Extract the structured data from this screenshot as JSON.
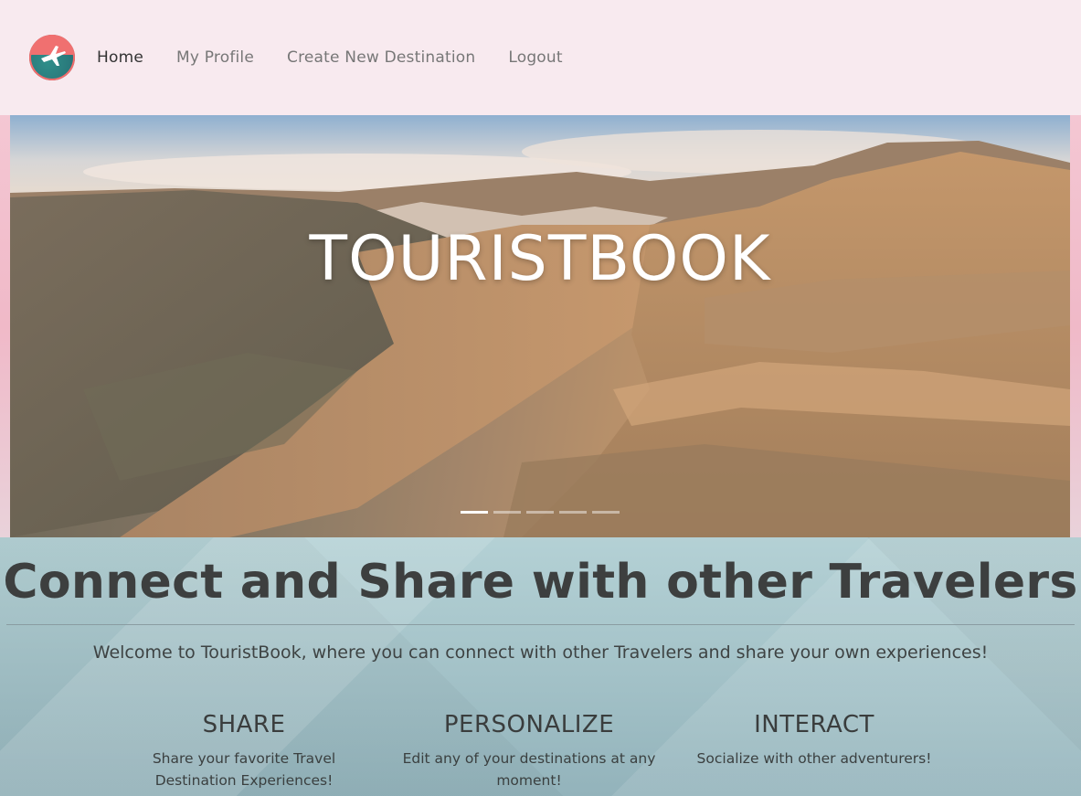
{
  "nav": {
    "links": [
      {
        "label": "Home",
        "active": true
      },
      {
        "label": "My Profile",
        "active": false
      },
      {
        "label": "Create New Destination",
        "active": false
      },
      {
        "label": "Logout",
        "active": false
      }
    ],
    "logo_icon": "airplane-globe-icon"
  },
  "hero": {
    "title": "TOURISTBOOK",
    "slides_count": 5,
    "active_slide": 0
  },
  "main": {
    "headline": "Connect and Share with other Travelers",
    "welcome": "Welcome to TouristBook, where you can connect with other Travelers and share your own experiences!",
    "features": [
      {
        "title": "SHARE",
        "text": "Share your favorite Travel Destination Experiences!"
      },
      {
        "title": "PERSONALIZE",
        "text": "Edit any of your destinations at any moment!"
      },
      {
        "title": "INTERACT",
        "text": "Socialize with other adventurers!"
      }
    ]
  },
  "colors": {
    "nav_bg": "#f8eaef",
    "logo_red": "#f07070",
    "logo_teal": "#2a7a7c",
    "text_dark": "#3d3f3f"
  }
}
